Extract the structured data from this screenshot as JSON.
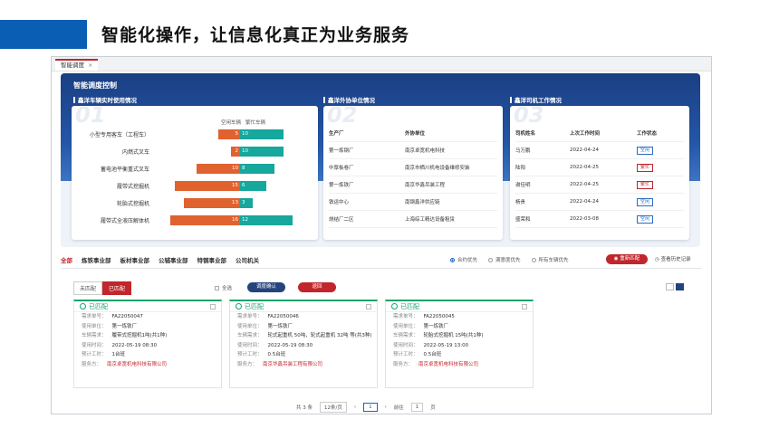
{
  "slide": {
    "title": "智能化操作，让信息化真正为业务服务"
  },
  "tab": {
    "label": "智能调度",
    "close": "×"
  },
  "hero": {
    "title": "智能调度控制"
  },
  "panels": [
    {
      "title": "鑫洋车辆实时使用情况",
      "num": "01"
    },
    {
      "title": "鑫洋外协单位情况",
      "num": "02"
    },
    {
      "title": "鑫洋司机工作情况",
      "num": "03"
    }
  ],
  "vehicle_chart": {
    "legend_idle": "空闲车辆",
    "legend_busy": "繁忙车辆",
    "colors": {
      "idle": "#e0622f",
      "busy": "#16a79d"
    },
    "rows": [
      {
        "label": "小型专用客车（工程车）",
        "idle": 5,
        "busy": 10
      },
      {
        "label": "内燃式叉车",
        "idle": 2,
        "busy": 10
      },
      {
        "label": "蓄电池平衡重式叉车",
        "idle": 10,
        "busy": 8
      },
      {
        "label": "履带式挖掘机",
        "idle": 15,
        "busy": 6
      },
      {
        "label": "轮胎式挖掘机",
        "idle": 13,
        "busy": 3
      },
      {
        "label": "履带式全液压解体机",
        "idle": 16,
        "busy": 12
      }
    ]
  },
  "partner_table": {
    "headers": [
      "生产厂",
      "外协单位"
    ],
    "rows": [
      [
        "第一炼钢厂",
        "南京卓宽机电科技"
      ],
      [
        "中厚板卷厂",
        "南京市栖川机电设备维修安装"
      ],
      [
        "第一炼铁厂",
        "南京华鑫吊装工程"
      ],
      [
        "铁运中心",
        "南钢鑫洋供应链"
      ],
      [
        "烧结厂二区",
        "上海综工精达设备租赁"
      ]
    ]
  },
  "driver_table": {
    "headers": [
      "司机姓名",
      "上次工作时间",
      "工作状态"
    ],
    "rows": [
      {
        "name": "马万鹏",
        "date": "2022-04-24",
        "status": "空闲",
        "busy": false
      },
      {
        "name": "陆阳",
        "date": "2022-04-25",
        "status": "繁忙",
        "busy": true
      },
      {
        "name": "谢佳明",
        "date": "2022-04-25",
        "status": "繁忙",
        "busy": true
      },
      {
        "name": "杨贵",
        "date": "2022-04-24",
        "status": "空闲",
        "busy": false
      },
      {
        "name": "盛荣和",
        "date": "2022-03-08",
        "status": "空闲",
        "busy": false
      }
    ]
  },
  "departments": [
    "全部",
    "炼铁事业部",
    "板材事业部",
    "公辅事业部",
    "特钢事业部",
    "公司机关"
  ],
  "radios": [
    {
      "label": "合约优先",
      "on": true
    },
    {
      "label": "满意度优先",
      "on": false
    },
    {
      "label": "所有车辆优先",
      "on": false
    }
  ],
  "actions": {
    "rematch": "重新匹配",
    "history": "查看历史记录"
  },
  "match_tabs": [
    "未匹配",
    "已匹配"
  ],
  "toolbar": {
    "select_all": "全选",
    "confirm": "调度确认",
    "reject": "退回"
  },
  "orders": [
    {
      "status": "已匹配",
      "fields": [
        [
          "需求单号：",
          "FA22050047"
        ],
        [
          "使用单位：",
          "第一炼铁厂"
        ],
        [
          "车辆需求：",
          "履带式挖掘机1吨(共1种)"
        ],
        [
          "使用时间：",
          "2022-05-19 08:30"
        ],
        [
          "预计工时：",
          "1台班"
        ],
        [
          "服务方：",
          "南京卓宽机电科技有限公司"
        ]
      ]
    },
    {
      "status": "已匹配",
      "fields": [
        [
          "需求单号：",
          "FA22050046"
        ],
        [
          "使用单位：",
          "第一炼铁厂"
        ],
        [
          "车辆需求：",
          "轮式起重机 50吨，轮式起重机 32吨 等(共3种)"
        ],
        [
          "使用时间：",
          "2022-05-19 08:30"
        ],
        [
          "预计工时：",
          "0.5台班"
        ],
        [
          "服务方：",
          "南京华鑫吊装工程有限公司"
        ]
      ]
    },
    {
      "status": "已匹配",
      "fields": [
        [
          "需求单号：",
          "FA22050045"
        ],
        [
          "使用单位：",
          "第一炼铁厂"
        ],
        [
          "车辆需求：",
          "轮胎式挖掘机 15吨(共1种)"
        ],
        [
          "使用时间：",
          "2022-05-19 13:00"
        ],
        [
          "预计工时：",
          "0.5台班"
        ],
        [
          "服务方：",
          "南京卓宽机电科技有限公司"
        ]
      ]
    }
  ],
  "pager": {
    "total": "共 3 条",
    "page_size": "12条/页",
    "prev": "‹",
    "current": "1",
    "next": "›",
    "goto": "前往",
    "goto_page": "1",
    "page_unit": "页"
  }
}
